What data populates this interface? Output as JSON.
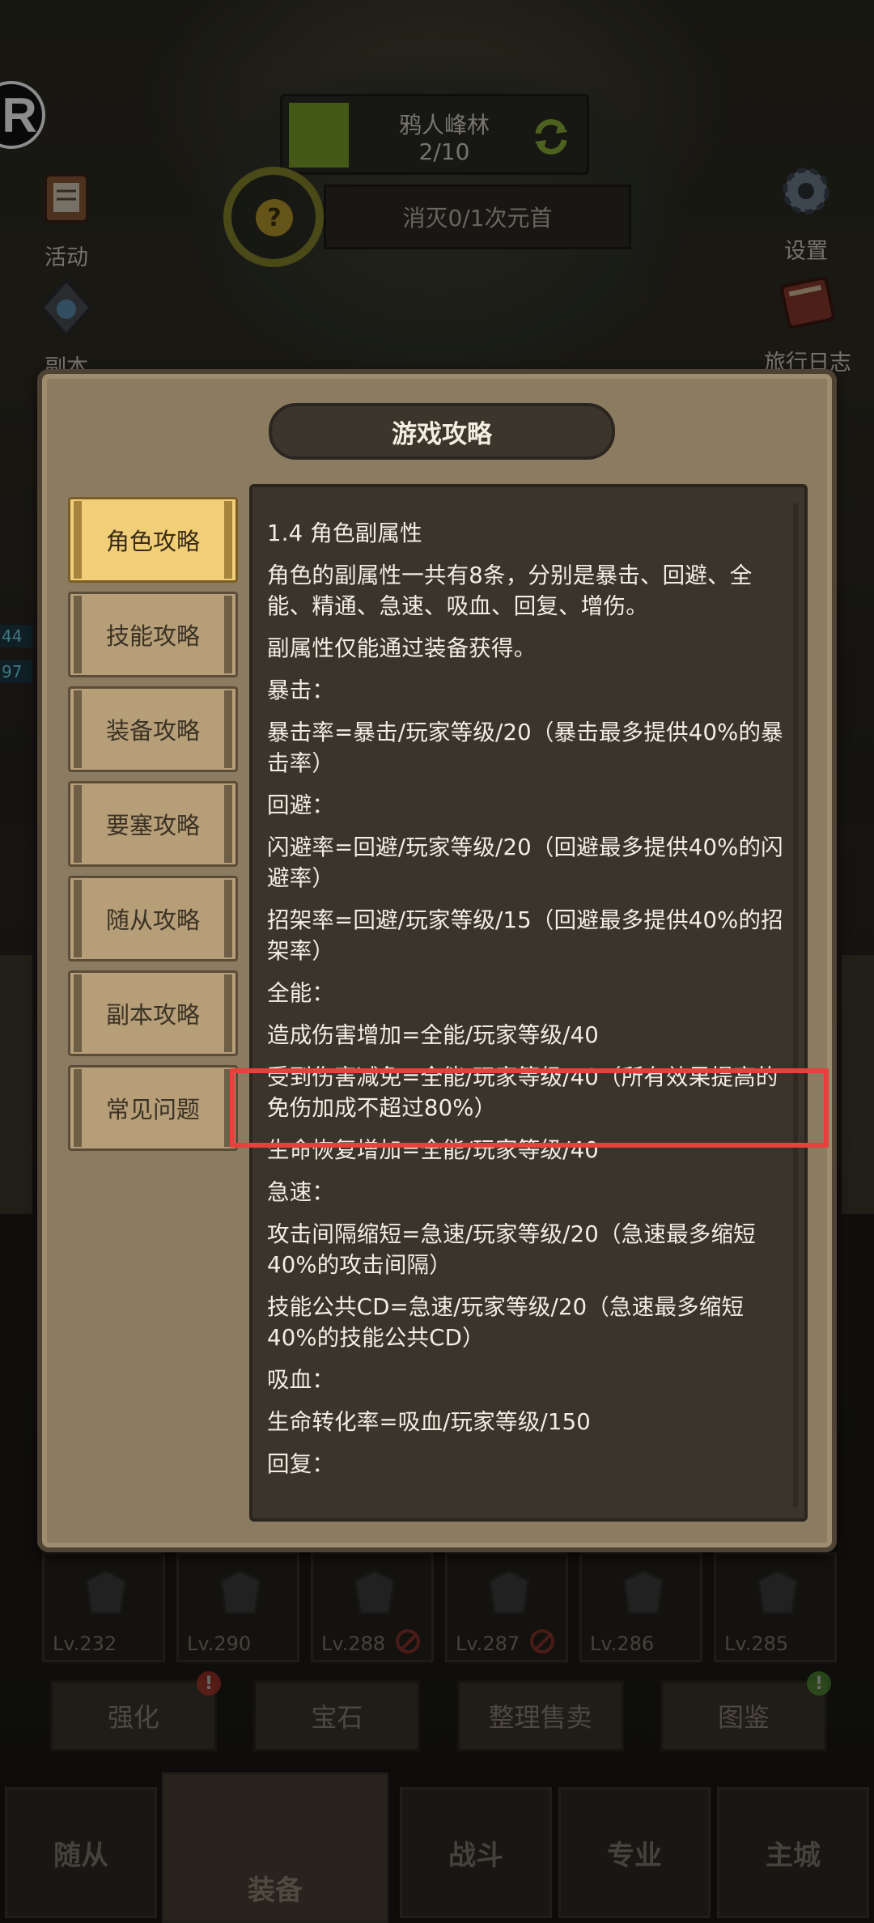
{
  "hud": {
    "zone_name": "鸦人峰林",
    "zone_progress": "2/10",
    "quest_mark": "?",
    "quest_text": "消灭0/1次元首",
    "activity_label": "活动",
    "dungeon_label": "副本",
    "settings_label": "设置",
    "journal_label": "旅行日志",
    "side_num_1": "44",
    "side_num_2": "97",
    "r_badge": "R"
  },
  "modal": {
    "title": "游戏攻略",
    "tabs": [
      {
        "label": "角色攻略",
        "active": true
      },
      {
        "label": "技能攻略",
        "active": false
      },
      {
        "label": "装备攻略",
        "active": false
      },
      {
        "label": "要塞攻略",
        "active": false
      },
      {
        "label": "随从攻略",
        "active": false
      },
      {
        "label": "副本攻略",
        "active": false
      },
      {
        "label": "常见问题",
        "active": false
      }
    ],
    "lines": [
      "1.4 角色副属性",
      "角色的副属性一共有8条，分别是暴击、回避、全能、精通、急速、吸血、回复、增伤。",
      "副属性仅能通过装备获得。",
      "暴击：",
      "暴击率=暴击/玩家等级/20（暴击最多提供40%的暴击率）",
      "回避：",
      "闪避率=回避/玩家等级/20（回避最多提供40%的闪避率）",
      "招架率=回避/玩家等级/15（回避最多提供40%的招架率）",
      "全能：",
      "造成伤害增加=全能/玩家等级/40",
      "受到伤害减免=全能/玩家等级/40（所有效果提高的免伤加成不超过80%）",
      "生命恢复增加=全能/玩家等级/40",
      "急速：",
      "攻击间隔缩短=急速/玩家等级/20（急速最多缩短40%的攻击间隔）",
      "技能公共CD=急速/玩家等级/20（急速最多缩短40%的技能公共CD）",
      "吸血：",
      "生命转化率=吸血/玩家等级/150",
      "回复："
    ]
  },
  "equipment": [
    {
      "level": "Lv.232",
      "banned": false
    },
    {
      "level": "Lv.290",
      "banned": false
    },
    {
      "level": "Lv.288",
      "banned": true
    },
    {
      "level": "Lv.287",
      "banned": true
    },
    {
      "level": "Lv.286",
      "banned": false
    },
    {
      "level": "Lv.285",
      "banned": false
    }
  ],
  "actions": {
    "enhance": "强化",
    "gem": "宝石",
    "sort_sell": "整理售卖",
    "codex": "图鉴",
    "alert_mark": "!"
  },
  "tabbar": {
    "followers": "随从",
    "equipment": "装备",
    "battle": "战斗",
    "profession": "专业",
    "main_city": "主城"
  },
  "colors": {
    "highlight": "#e8403c",
    "active_tab": "#f1cf79",
    "zone_swatch": "#7ea22a"
  }
}
